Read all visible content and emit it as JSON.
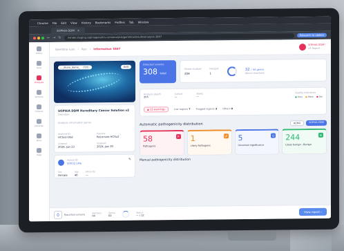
{
  "os_menu": [
    "Chrome",
    "File",
    "Edit",
    "View",
    "History",
    "Bookmarks",
    "Profiles",
    "Tab",
    "Window",
    "Help"
  ],
  "browser": {
    "tab_title": "SOPHiA DDM",
    "url": "/render.staging.sophiagenetics.com/analysis/germline/results/analysis-3807",
    "relaunch": "Relaunch to update"
  },
  "sidebar": [
    {
      "label": "Home",
      "active": false
    },
    {
      "label": "Runs",
      "active": false
    },
    {
      "label": "Analyses",
      "active": true
    },
    {
      "label": "Variants",
      "active": false
    },
    {
      "label": "Cohorts",
      "active": false
    },
    {
      "label": "Libraries",
      "active": false
    },
    {
      "label": "Docs",
      "active": false
    },
    {
      "label": "Help",
      "active": false
    }
  ],
  "breadcrumb": {
    "root": "Germline runs",
    "mid": "Run",
    "current": "Information 3807"
  },
  "user": {
    "name": "SOPHIA DDM*",
    "sub": "v3 Report"
  },
  "hero": {
    "chip": "..._illumi_demo_",
    "tag": "TOC",
    "edit": "Edit"
  },
  "info": {
    "title": "SOPHiA DDM Hereditary Cancer Solution v2",
    "subtitle": "Germline",
    "section_label": "Analysis information panel",
    "kv": [
      {
        "k": "Analysis ID",
        "v": "HCSv2-Dkd"
      },
      {
        "k": "Pipeline",
        "v": "Recursive HCSv2"
      },
      {
        "k": "Created",
        "v": "2024, Jan 23"
      },
      {
        "k": "Updated",
        "v": "2024, Jan 30"
      }
    ]
  },
  "patient": {
    "label": "Patient ID",
    "id": "50032 LMa",
    "fields": [
      {
        "k": "Sex",
        "v": "Female"
      },
      {
        "k": "Age",
        "v": "46"
      },
      {
        "k": "Ethnicity",
        "v": "—"
      }
    ]
  },
  "stats": {
    "variants_label": "Detected variants",
    "variants": "308",
    "variants_unit": "total",
    "pairs": [
      {
        "k": "Genes studied",
        "v": "208"
      },
      {
        "k": "Hotspot",
        "v": "1"
      }
    ],
    "coverage_value": "32",
    "coverage_of": "/ 44 genes",
    "coverage_label": "Above threshold"
  },
  "analysis_block": {
    "fields": [
      {
        "k": "Analysis depth",
        "v": "205"
      },
      {
        "k": "Cohort",
        "v": "—"
      },
      {
        "k": "Alerts",
        "v": "—"
      }
    ],
    "qi_label": "Quality indicators",
    "qi": [
      {
        "label": "Pass",
        "kind": "pass"
      },
      {
        "label": "Warn",
        "kind": "warn"
      },
      {
        "label": "Fail",
        "kind": "fail"
      }
    ],
    "warnings": "12 warnings",
    "warn_items": [
      {
        "k": "Low regions",
        "v": "7"
      },
      {
        "k": "Flagged regions",
        "v": "3"
      },
      {
        "k": "Others",
        "v": "0"
      }
    ]
  },
  "distribution": {
    "title": "Automatic pathogenicity distribution",
    "actions": [
      "ACMG",
      "SOPHiA DDM"
    ],
    "cards": [
      {
        "num": "58",
        "label": "Pathogenic",
        "badge": "P",
        "cls": "p"
      },
      {
        "num": "1",
        "label": "Likely Pathogenic",
        "badge": "LP",
        "cls": "lp"
      },
      {
        "num": "5",
        "label": "Uncertain significance",
        "badge": "U",
        "cls": "u"
      },
      {
        "num": "244",
        "label": "Likely benign - Benign",
        "badge": "B",
        "cls": "lb"
      }
    ],
    "next_section": "Manual pathogenicity distribution"
  },
  "bottom": {
    "count": "0",
    "count_label": "Reported variants",
    "pairs": [
      {
        "k": "Samples",
        "v": "04"
      },
      {
        "k": "Genes",
        "v": "02"
      }
    ],
    "ring_k": "Status",
    "ring_v": "— / 12",
    "view_report": "View report"
  },
  "colors": {
    "accent": "#4b74e6",
    "brand": "#e5305a"
  }
}
